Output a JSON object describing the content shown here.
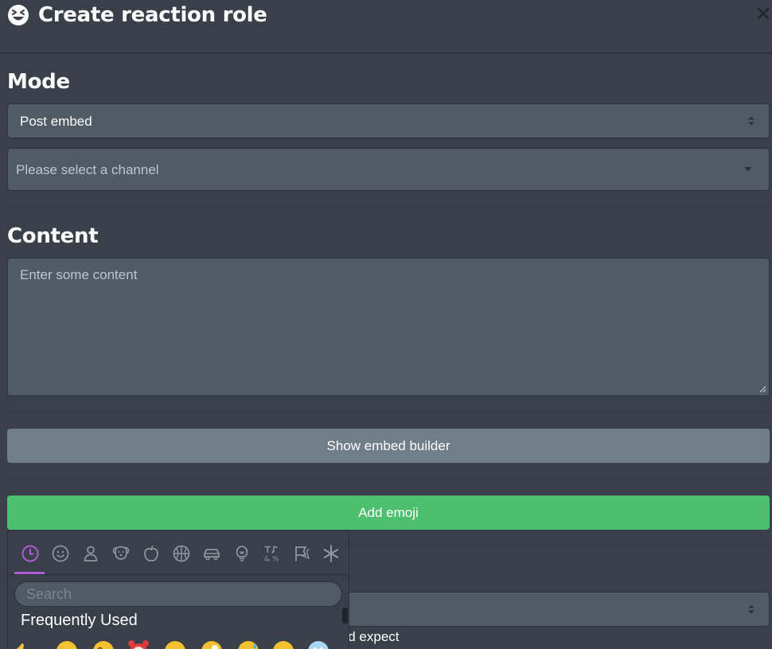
{
  "header": {
    "title": "Create reaction role",
    "title_icon": "grinning-squint-face-icon",
    "close_icon": "close-icon"
  },
  "mode": {
    "heading": "Mode",
    "mode_select_value": "Post embed",
    "channel_select_placeholder": "Please select a channel"
  },
  "content": {
    "heading": "Content",
    "textarea_placeholder": "Enter some content"
  },
  "buttons": {
    "show_embed_builder": "Show embed builder",
    "add_emoji": "Add emoji"
  },
  "emoji_picker": {
    "categories": [
      "frequently-used-icon",
      "smileys-icon",
      "people-icon",
      "animals-icon",
      "food-icon",
      "activities-icon",
      "travel-icon",
      "objects-icon",
      "symbols-icon",
      "flags-icon",
      "custom-icon"
    ],
    "active_category": "frequently-used-icon",
    "search_placeholder": "Search",
    "section_label": "Frequently Used",
    "accent_color": "#b05cd6"
  },
  "behind_picker": {
    "hint_text": "'d expect"
  },
  "colors": {
    "background": "#3a404a",
    "input_bg": "#505b66",
    "gray_button": "#707e8a",
    "green_button": "#4dbf6e"
  }
}
